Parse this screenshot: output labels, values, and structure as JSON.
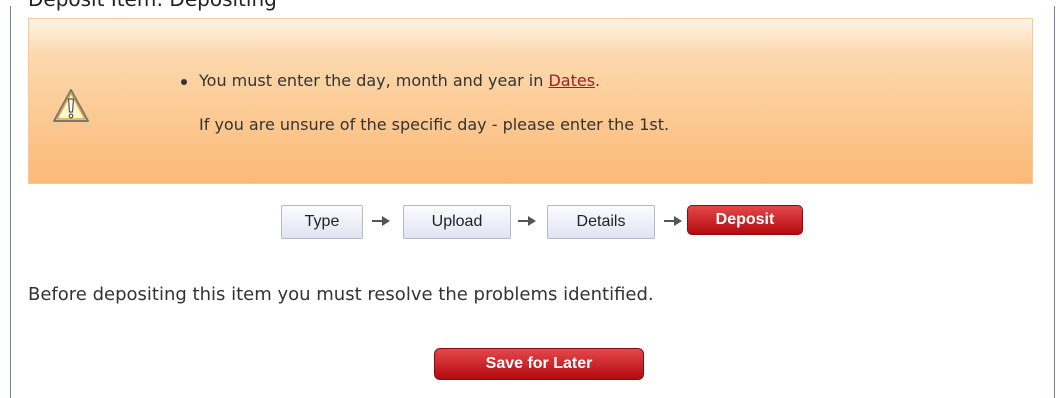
{
  "header": {
    "title_partial": "Deposit Item: Depositing"
  },
  "problems": {
    "items": [
      {
        "text_before_link": "You must enter the day, month and year in ",
        "link_text": "Dates",
        "text_after_link": ".",
        "subtext": "If you are unsure of the specific day - please enter the 1st."
      }
    ],
    "icon": "warning-icon"
  },
  "workflow": {
    "steps": [
      {
        "label": "Type",
        "active": false
      },
      {
        "label": "Upload",
        "active": false
      },
      {
        "label": "Details",
        "active": false
      },
      {
        "label": "Deposit",
        "active": true
      }
    ]
  },
  "notice": "Before depositing this item you must resolve the problems identified.",
  "actions": {
    "save_later_label": "Save for Later"
  },
  "colors": {
    "accent_red": "#b40b0f",
    "warning_orange": "#fbb976",
    "link_red": "#a51d1d"
  }
}
